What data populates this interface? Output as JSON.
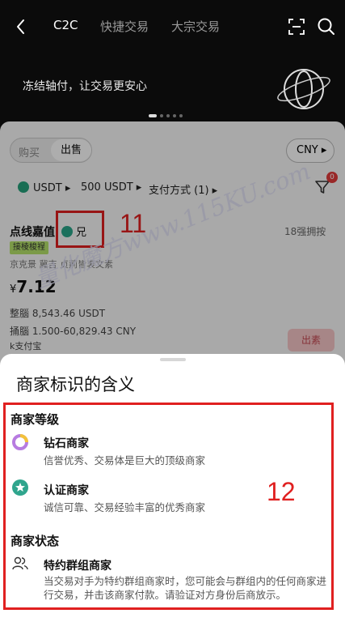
{
  "header": {
    "back_icon": "chevron-left-icon",
    "tabs": [
      {
        "label": "C2C"
      },
      {
        "label": "快捷交易"
      },
      {
        "label": "大宗交易"
      }
    ],
    "scan_icon": "scan-icon",
    "search_icon": "search-icon",
    "banner_text": "冻结轴付，让交易更安心"
  },
  "trade": {
    "buy_label": "购买",
    "sell_label": "出售",
    "currency": "CNY ▸",
    "filters": {
      "coin": "USDT ▸",
      "amount": "500 USDT ▸",
      "payment": "支付方式 (1) ▸"
    },
    "filter_badge": "0"
  },
  "merchant": {
    "name": "点线嘉值",
    "badge_text": "兄",
    "vip_text": "18强拥按",
    "lightning_tag": "接棱梭裎",
    "stats_line": "京克景 冀吉 贞荊皆衷文素",
    "price_currency": "¥",
    "price": "7.12",
    "quantity": "整腦 8,543.46 USDT",
    "limits": "捅腦 1.500-60,829.43 CNY",
    "payment": "k支付宝",
    "sell_button": "出素"
  },
  "annotations": {
    "label_11": "11",
    "label_12": "12",
    "watermark": "量化魔方www.115KU.com",
    "color": "#e02020"
  },
  "sheet": {
    "title": "商家标识的含义",
    "level_section": "商家等级",
    "levels": [
      {
        "icon": "diamond-merchant-icon",
        "title": "钻石商家",
        "desc": "信誉优秀、交易体是巨大的顶级商家"
      },
      {
        "icon": "verified-merchant-icon",
        "title": "认证商家",
        "desc": "诚信可靠、交易经验丰富的优秀商家"
      }
    ],
    "status_section": "商家状态",
    "group": {
      "icon": "group-users-icon",
      "title": "特约群组商家",
      "desc": "当交易对手为特约群组商家时，您可能会与群组内的任何商家进行交易，并击该商家付款。请验证对方身份后商放示。"
    }
  }
}
